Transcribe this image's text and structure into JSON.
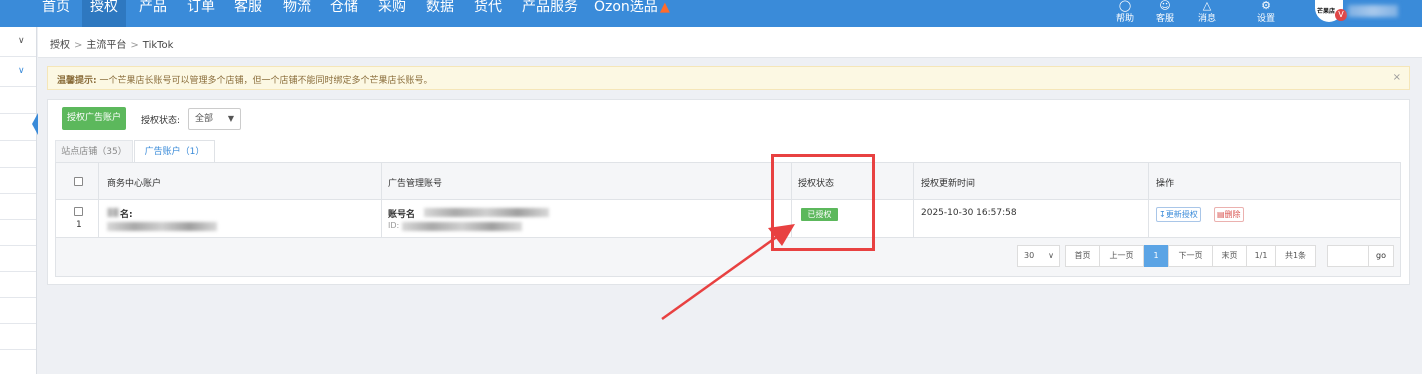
{
  "nav": {
    "items": [
      "首页",
      "授权",
      "产品",
      "订单",
      "客服",
      "物流",
      "仓储",
      "采购",
      "数据",
      "货代",
      "产品服务",
      "Ozon选品"
    ],
    "active": "授权",
    "tools": [
      {
        "icon": "help-icon",
        "label": "帮助"
      },
      {
        "icon": "customer-service-icon",
        "label": "客服"
      },
      {
        "icon": "bell-icon",
        "label": "消息"
      },
      {
        "icon": "gear-icon",
        "label": "设置"
      }
    ],
    "avatar_text": "芒果店",
    "avatar_badge": "V"
  },
  "breadcrumb": [
    "授权",
    "主流平台",
    "TikTok"
  ],
  "tip": {
    "label": "温馨提示:",
    "text": "一个芒果店长账号可以管理多个店铺，但一个店铺不能同时绑定多个芒果店长账号。",
    "close": "×"
  },
  "toolbar": {
    "auth_button": "授权广告账户",
    "status_label": "授权状态:",
    "status_value": "全部"
  },
  "tabs": [
    {
      "label": "站点店铺（35）",
      "active": false
    },
    {
      "label": "广告账户（1）",
      "active": true
    }
  ],
  "table": {
    "headers": [
      "商务中心账户",
      "广告管理账号",
      "授权状态",
      "授权更新时间",
      "操作"
    ],
    "rows": [
      {
        "index": "1",
        "bc_account_prefix": "名:",
        "ad_account_prefix": "账号名",
        "ad_id_prefix": "ID:",
        "status": "已授权",
        "updated": "2025-10-30 16:57:58",
        "actions": [
          "更新授权",
          "删除"
        ]
      }
    ]
  },
  "pagination": {
    "page_size": "30",
    "first": "首页",
    "prev": "上一页",
    "current": "1",
    "next": "下一页",
    "last": "末页",
    "pages": "1/1",
    "total": "共1条",
    "go": "go"
  },
  "colors": {
    "nav_bg": "#3a8bd9",
    "primary_green": "#5cb85c",
    "annotation_red": "#e84141"
  }
}
